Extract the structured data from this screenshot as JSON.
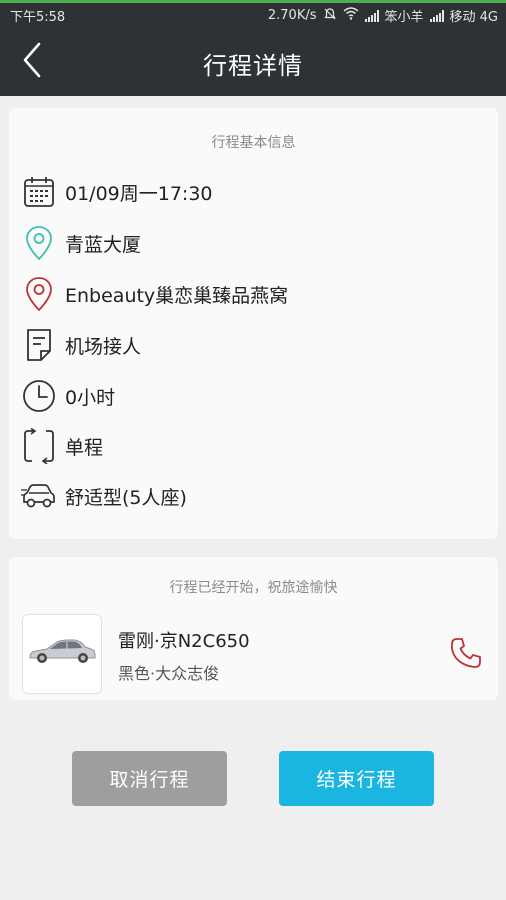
{
  "status_bar": {
    "time": "下午5:58",
    "speed": "2.70K/s",
    "carrier1": "笨小羊",
    "carrier2": "移动 4G",
    "progress_fraction": 1.0
  },
  "header": {
    "title": "行程详情"
  },
  "trip_info": {
    "heading": "行程基本信息",
    "datetime": "01/09周一17:30",
    "start": "青蓝大厦",
    "destination": "Enbeauty巢恋巢臻品燕窝",
    "purpose": "机场接人",
    "duration": "0小时",
    "trip_type": "单程",
    "car_type": "舒适型(5人座)"
  },
  "driver": {
    "heading": "行程已经开始，祝旅途愉快",
    "plate": "雷刚·京N2C650",
    "car_model": "黑色·大众志俊"
  },
  "actions": {
    "cancel": "取消行程",
    "end": "结束行程"
  },
  "colors": {
    "accent": "#1ab5e0",
    "start_pin": "#3cc0b0",
    "end_pin": "#c0303a",
    "phone": "#c0303a"
  }
}
